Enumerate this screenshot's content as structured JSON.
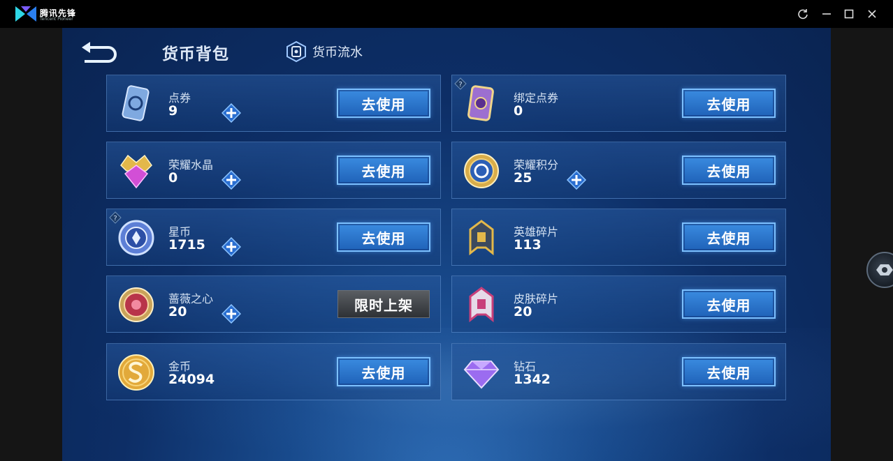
{
  "window": {
    "brand_name": "腾讯先锋",
    "brand_sub": "Tencent Pioneer",
    "controls": [
      "refresh-icon",
      "minimize-icon",
      "maximize-icon",
      "close-icon"
    ]
  },
  "header": {
    "title": "货币背包",
    "flow_label": "货币流水"
  },
  "currencies": [
    {
      "name": "点券",
      "amount": "9",
      "plus": true,
      "button": "去使用",
      "icon": "coupon-icon",
      "help": false
    },
    {
      "name": "绑定点券",
      "amount": "0",
      "plus": false,
      "button": "去使用",
      "icon": "bound-coupon-icon",
      "help": true
    },
    {
      "name": "荣耀水晶",
      "amount": "0",
      "plus": true,
      "button": "去使用",
      "icon": "glory-crystal-icon",
      "help": false
    },
    {
      "name": "荣耀积分",
      "amount": "25",
      "plus": true,
      "button": "去使用",
      "icon": "glory-points-icon",
      "help": false
    },
    {
      "name": "星币",
      "amount": "1715",
      "plus": true,
      "button": "去使用",
      "icon": "star-coin-icon",
      "help": true
    },
    {
      "name": "英雄碎片",
      "amount": "113",
      "plus": false,
      "button": "去使用",
      "icon": "hero-fragment-icon",
      "help": false
    },
    {
      "name": "蔷薇之心",
      "amount": "20",
      "plus": true,
      "button": "限时上架",
      "icon": "rose-heart-icon",
      "help": false,
      "limited": true
    },
    {
      "name": "皮肤碎片",
      "amount": "20",
      "plus": false,
      "button": "去使用",
      "icon": "skin-fragment-icon",
      "help": false
    },
    {
      "name": "金币",
      "amount": "24094",
      "plus": false,
      "button": "去使用",
      "icon": "gold-coin-icon",
      "help": false
    },
    {
      "name": "钻石",
      "amount": "1342",
      "plus": false,
      "button": "去使用",
      "icon": "diamond-icon",
      "help": false
    }
  ],
  "colors": {
    "accent": "#3a8be0",
    "background": "#0d2e66"
  }
}
